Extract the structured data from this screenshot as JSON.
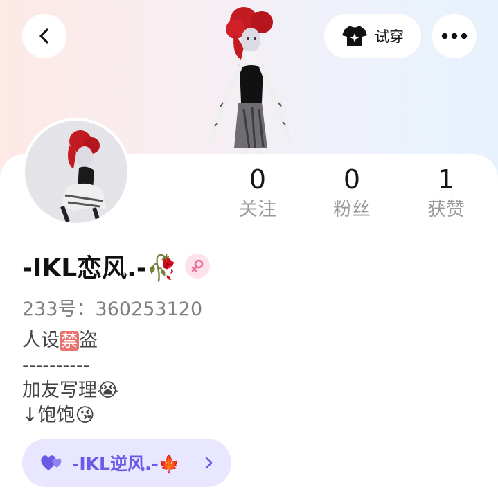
{
  "header": {
    "tryon_label": "试穿"
  },
  "stats": [
    {
      "value": "0",
      "label": "关注"
    },
    {
      "value": "0",
      "label": "粉丝"
    },
    {
      "value": "1",
      "label": "获赞"
    }
  ],
  "profile": {
    "name": "-IKL恋风.-🥀",
    "id_line": "233号：360253120",
    "bio_line1_pre": "人设",
    "bio_line1_badge": "禁",
    "bio_line1_post": "盗",
    "bio_line2": "----------",
    "bio_line3": "加友写理😭",
    "bio_line4": "↓饱饱😘"
  },
  "linked": {
    "label": "-IKL逆风.-🍁"
  },
  "colors": {
    "accent": "#6a5be6",
    "pill_bg": "#e9e7ff",
    "gender_bg": "#fde2ea",
    "gender_icon": "#f06a9a"
  },
  "icons": {
    "back": "chevron-left-icon",
    "tryon": "tshirt-sparkle-icon",
    "more": "more-dots-icon",
    "gender": "female-icon",
    "link": "hearts-icon",
    "link_chevron": "chevron-right-icon"
  }
}
